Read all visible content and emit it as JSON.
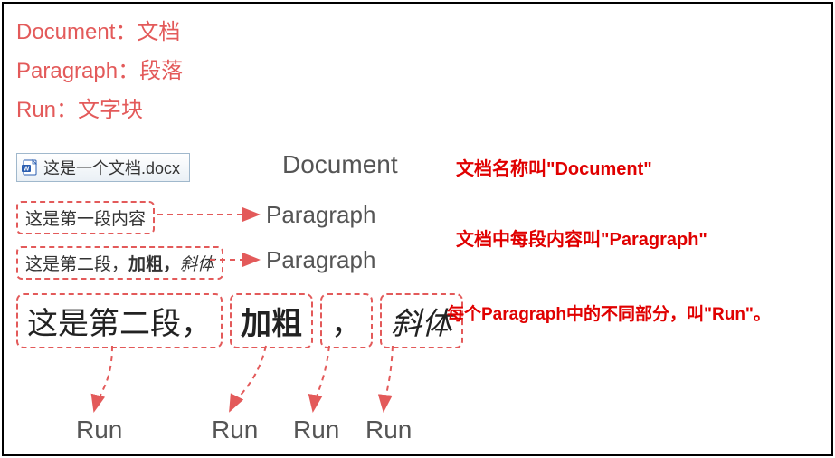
{
  "definitions": {
    "document": "Document：文档",
    "paragraph": "Paragraph：段落",
    "run": "Run：文字块"
  },
  "docfile": {
    "filename": "这是一个文档.docx"
  },
  "labels": {
    "document": "Document",
    "paragraph": "Paragraph",
    "run": "Run"
  },
  "paragraphs": {
    "p1": "这是第一段内容",
    "p2_normal": "这是第二段，",
    "p2_bold": "加粗，",
    "p2_italic": "斜体"
  },
  "runs": {
    "r1": "这是第二段，",
    "r2": "加粗",
    "r3": "，",
    "r4": "斜体"
  },
  "notes": {
    "doc": "文档名称叫\"Document\"",
    "par": "文档中每段内容叫\"Paragraph\"",
    "run": "每个Paragraph中的不同部分，叫\"Run\"。"
  },
  "colors": {
    "accent": "#e35a5a",
    "note": "#e00000",
    "label": "#555555"
  }
}
